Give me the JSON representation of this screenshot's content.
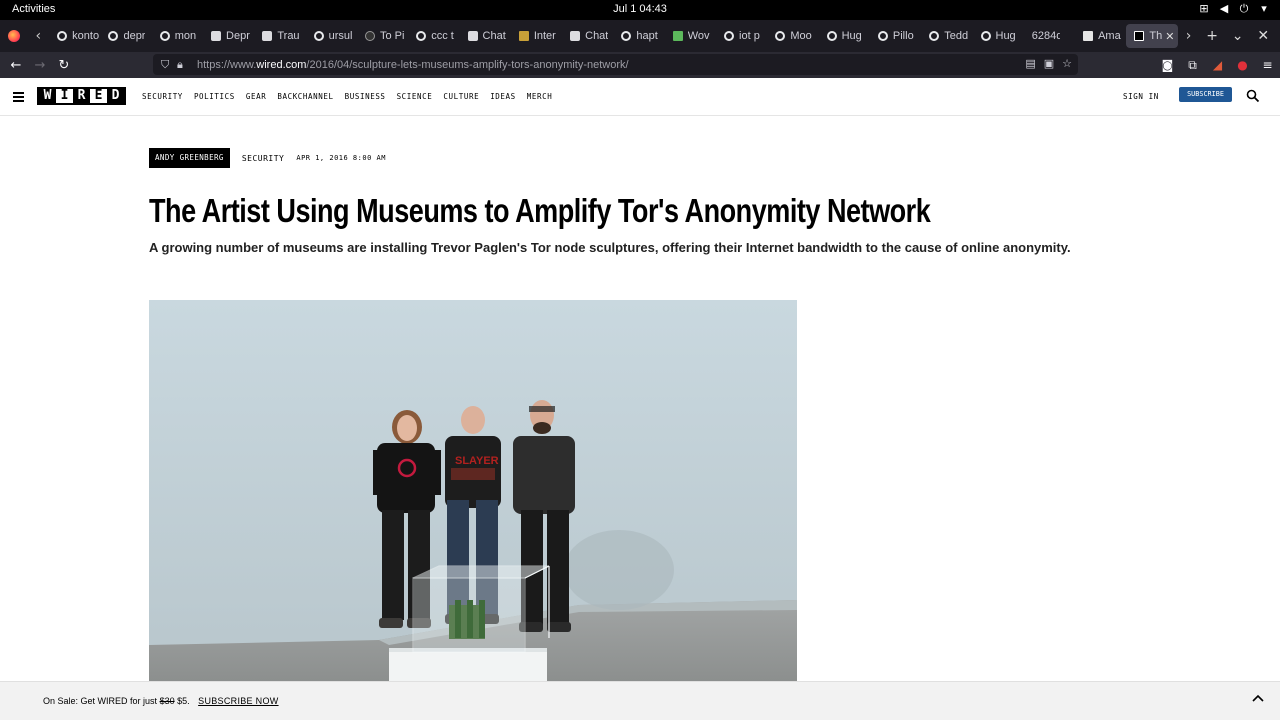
{
  "system": {
    "activities": "Activities",
    "clock": "Jul 1  04:43"
  },
  "tabs": [
    {
      "title": "konto",
      "icon": "google-icon"
    },
    {
      "title": "depr",
      "icon": "google-icon"
    },
    {
      "title": "mon",
      "icon": "google-icon"
    },
    {
      "title": "Depr",
      "icon": "chatgpt-icon"
    },
    {
      "title": "Trau",
      "icon": "chatgpt-icon"
    },
    {
      "title": "ursul",
      "icon": "google-icon"
    },
    {
      "title": "To Pi",
      "icon": "github-icon"
    },
    {
      "title": "ccc t",
      "icon": "google-icon"
    },
    {
      "title": "Chat",
      "icon": "chatgpt-icon"
    },
    {
      "title": "Inter",
      "icon": "pv-icon"
    },
    {
      "title": "Chat",
      "icon": "chatgpt-icon"
    },
    {
      "title": "hapt",
      "icon": "google-icon"
    },
    {
      "title": "Wov",
      "icon": "doc-icon"
    },
    {
      "title": "iot p",
      "icon": "google-icon"
    },
    {
      "title": "Moo",
      "icon": "google-icon"
    },
    {
      "title": "Hug",
      "icon": "google-icon"
    },
    {
      "title": "Pillo",
      "icon": "google-icon"
    },
    {
      "title": "Tedd",
      "icon": "google-icon"
    },
    {
      "title": "Hug",
      "icon": "google-icon"
    },
    {
      "title": "6284db",
      "icon": "none"
    },
    {
      "title": "Ama",
      "icon": "amazon-icon"
    },
    {
      "title": "Th",
      "icon": "wired-icon",
      "active": true
    }
  ],
  "address": {
    "url_prefix": "https://www.",
    "url_domain": "wired.com",
    "url_path": "/2016/04/sculpture-lets-museums-amplify-tors-anonymity-network/"
  },
  "site": {
    "logo_letters": [
      "W",
      "I",
      "R",
      "E",
      "D"
    ],
    "nav": [
      "SECURITY",
      "POLITICS",
      "GEAR",
      "BACKCHANNEL",
      "BUSINESS",
      "SCIENCE",
      "CULTURE",
      "IDEAS",
      "MERCH"
    ],
    "sign_in": "SIGN IN",
    "subscribe": "SUBSCRIBE"
  },
  "article": {
    "author": "ANDY GREENBERG",
    "category": "SECURITY",
    "date": "APR 1, 2016 8:00 AM",
    "headline": "The Artist Using Museums to Amplify Tor's Anonymity Network",
    "dek": "A growing number of museums are installing Trevor Paglen's Tor node sculptures, offering their Internet bandwidth to the cause of online anonymity."
  },
  "promo": {
    "prefix": "On Sale: Get WIRED for just",
    "old_price": "$30",
    "new_price": "$5.",
    "cta": "SUBSCRIBE NOW"
  },
  "colors": {
    "subscribe_button": "#1f5795",
    "browser_chrome": "#1c1b22",
    "toolbar": "#2b2a33"
  }
}
